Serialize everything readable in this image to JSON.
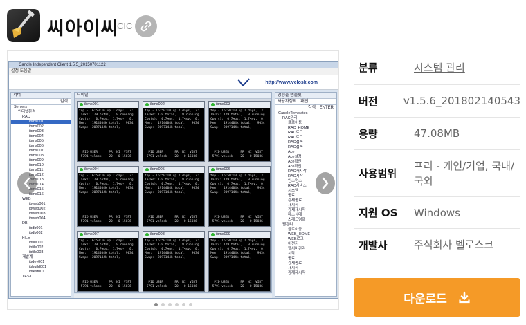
{
  "app": {
    "title": "씨아이씨",
    "abbr": "CIC",
    "link_icon": "link-icon",
    "logo_icon": "shovel-icon"
  },
  "screenshot": {
    "window_title": "Candle Independent Client 1.5.5_20150701122",
    "menu": "설정  도움말",
    "banner_url": "http://www.velosk.com",
    "left_tab": "서버",
    "left_search": "검색",
    "tree": [
      "Servers",
      "인터넷환경",
      "RAC",
      "ibms001",
      "ibms002",
      "ibms003",
      "ibms004",
      "ibms005",
      "ibms006",
      "ibms007",
      "ibms008",
      "ibms009",
      "ibms010",
      "ibms011",
      "ibms012",
      "ibms013",
      "ibms014",
      "ibms015",
      "ibms016",
      "WEB",
      "ibweb001",
      "ibweb002",
      "ibweb003",
      "ibweb004",
      "DB",
      "ibdb001",
      "ibdb002",
      "FILE",
      "ibfile001",
      "ibfile002",
      "ibfile003",
      "개발계",
      "ibdev001",
      "ibbuild001",
      "ibtest001",
      "TEST"
    ],
    "center_tab": "터미널",
    "terminals": [
      "ibms001",
      "ibms002",
      "ibms003",
      "ibms004",
      "ibms005",
      "ibms006",
      "ibms007",
      "ibms008",
      "ibms009"
    ],
    "term_text": "top - 16:50:10 up 2 days,  3:\nTasks: 179 total,   9 running\nCpu(s):  0.7%us,  1.7%sy,  0.\nMem:   1914404k total,   9034\nSwap:  2097144k total,\n\n\n\n\n\n  PID USER      PR  NI  VIRT\n 5791 velosk    20   0 15036",
    "right_tab": "명령을 템플릿",
    "right_subtab": "사용자정의",
    "right_subtab2": "패턴",
    "right_search": "검색",
    "right_enter": "ENTER",
    "right_tree": [
      "CandleTemplates",
      "RAC관리",
      "클로이동",
      "RAC_HOME",
      "RAC로그",
      "RAC로그",
      "RAC접속",
      "RAC접속",
      "Ace",
      "Ace설정",
      "Ace확인",
      "Ace확인",
      "RAC재시작",
      "RAC시작",
      "인스턴스",
      "RAC서비스",
      "시스템",
      "종료",
      "강제종료",
      "재시작",
      "강제재시작",
      "패스상태",
      "스레드덤프",
      "웹관리",
      "클로이동",
      "WEB_HOME",
      "WEB로그",
      "이전저",
      "웹서버관리",
      "시작",
      "종료",
      "강제종료",
      "재시작",
      "강제재시작"
    ],
    "status": "B0.6 / 4708 | 209%",
    "toolbar_input": "Line"
  },
  "info": {
    "rows": [
      {
        "label": "분류",
        "value": "시스템 관리"
      },
      {
        "label": "버전",
        "value": "v1.5.6_201802140543"
      },
      {
        "label": "용량",
        "value": "47.08MB"
      },
      {
        "label": "사용범위",
        "value": "프리 - 개인/기업, 국내/국외"
      },
      {
        "label": "지원 OS",
        "value": "Windows"
      },
      {
        "label": "개발사",
        "value": "주식회사 벨로스크"
      }
    ]
  },
  "download": {
    "label": "다운로드",
    "icon": "download-icon"
  },
  "colors": {
    "accent": "#f59a27",
    "link_button": "#b5b5b5"
  }
}
